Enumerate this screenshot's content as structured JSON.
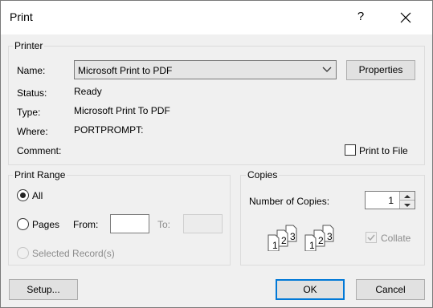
{
  "window": {
    "title": "Print",
    "help_glyph": "?"
  },
  "printer": {
    "group_label": "Printer",
    "name_label": "Name:",
    "name_value": "Microsoft Print to PDF",
    "properties_label": "Properties",
    "status_label": "Status:",
    "status_value": "Ready",
    "type_label": "Type:",
    "type_value": "Microsoft Print To PDF",
    "where_label": "Where:",
    "where_value": "PORTPROMPT:",
    "comment_label": "Comment:",
    "print_to_file_label": "Print to File",
    "print_to_file_checked": false
  },
  "print_range": {
    "group_label": "Print Range",
    "all_label": "All",
    "pages_label": "Pages",
    "from_label": "From:",
    "from_value": "",
    "to_label": "To:",
    "to_value": "",
    "selected_records_label": "Selected Record(s)",
    "selected": "All"
  },
  "copies": {
    "group_label": "Copies",
    "number_label": "Number of Copies:",
    "number_value": "1",
    "collate_label": "Collate",
    "collate_checked": true,
    "collate_enabled": false,
    "page_numbers": [
      "1",
      "2",
      "3"
    ]
  },
  "footer": {
    "setup_label": "Setup...",
    "ok_label": "OK",
    "cancel_label": "Cancel"
  },
  "colors": {
    "focus_border": "#0078d7",
    "title_bar": "#ffffff",
    "dialog_bg": "#f0f0f0"
  }
}
